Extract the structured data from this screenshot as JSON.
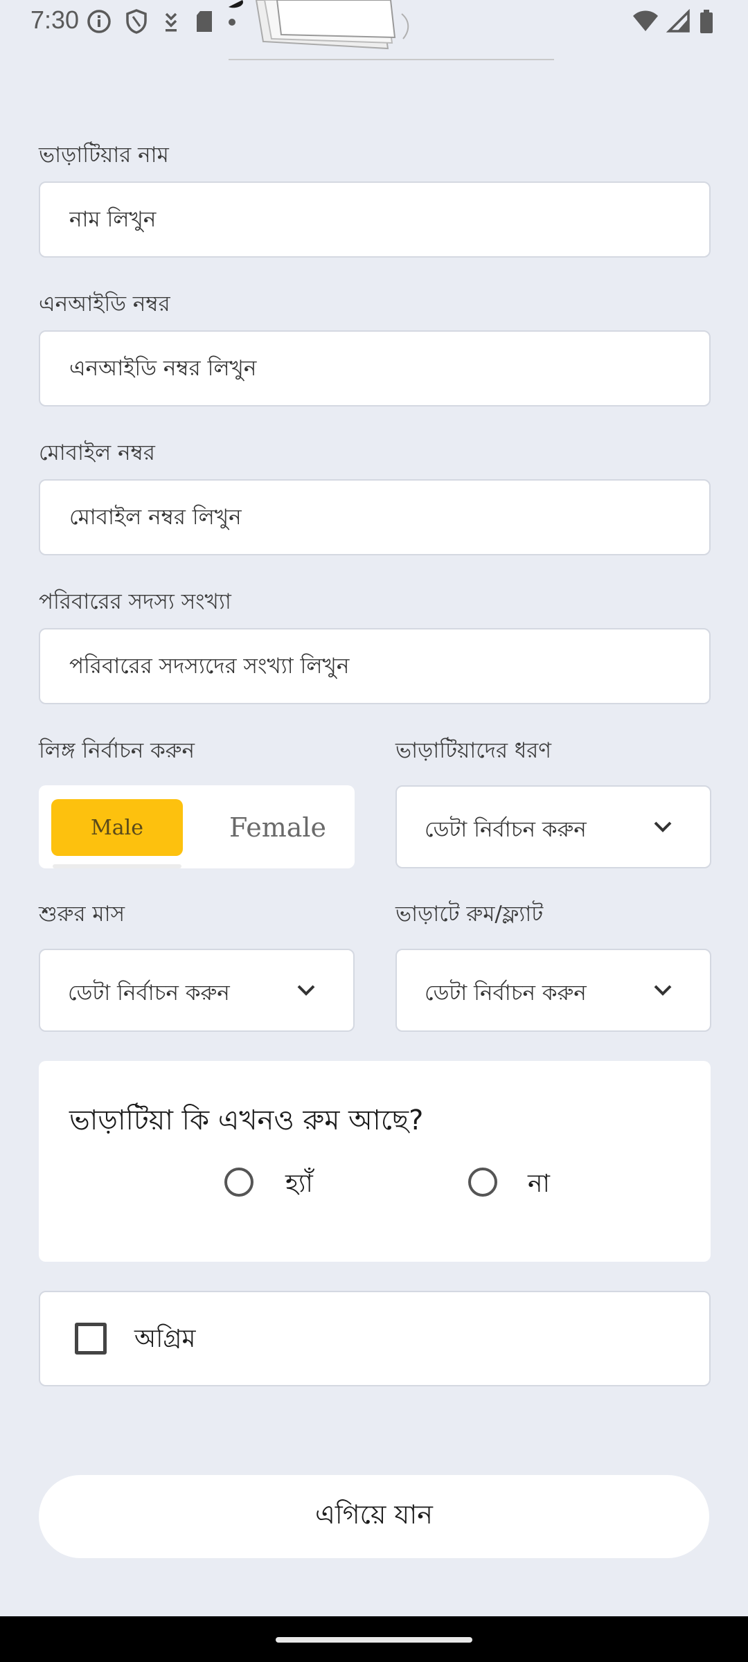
{
  "status_bar": {
    "time": "7:30",
    "left_icons": [
      "info-icon",
      "shield-icon",
      "download-icon",
      "sd-card-icon",
      "dot-icon"
    ],
    "right_icons": [
      "wifi-icon",
      "signal-icon",
      "battery-icon"
    ]
  },
  "form": {
    "tenant_name": {
      "label": "ভাড়াটিয়ার নাম",
      "placeholder": "নাম লিখুন"
    },
    "nid": {
      "label": "এনআইডি নম্বর",
      "placeholder": "এনআইডি নম্বর লিখুন"
    },
    "mobile": {
      "label": "মোবাইল নম্বর",
      "placeholder": "মোবাইল নম্বর লিখুন"
    },
    "family_members": {
      "label": "পরিবারের সদস্য সংখ্যা",
      "placeholder": "পরিবারের সদস্যদের সংখ্যা লিখুন"
    },
    "gender": {
      "label": "লিঙ্গ নির্বাচন করুন",
      "options": [
        "Male",
        "Female"
      ],
      "selected": "Male"
    },
    "tenant_type": {
      "label": "ভাড়াটিয়াদের ধরণ",
      "value": "ডেটা নির্বাচন করুন"
    },
    "start_month": {
      "label": "শুরুর মাস",
      "value": "ডেটা নির্বাচন করুন"
    },
    "rented_unit": {
      "label": "ভাড়াটে রুম/ফ্ল্যাট",
      "value": "ডেটা নির্বাচন করুন"
    },
    "still_in_room": {
      "question": "ভাড়াটিয়া কি এখনও রুম আছে?",
      "yes": "হ্যাঁ",
      "no": "না"
    },
    "advance": {
      "label": "অগ্রিম"
    },
    "submit": {
      "label": "এগিয়ে যান"
    }
  },
  "colors": {
    "background": "#e9ecf3",
    "accent": "#fdc10e"
  }
}
